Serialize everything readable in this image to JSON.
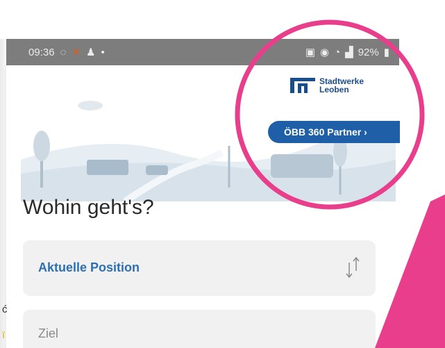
{
  "status_bar": {
    "time": "09:36",
    "battery": "92%"
  },
  "logo": {
    "line1": "Stadtwerke",
    "line2": "Leoben"
  },
  "partner_button": {
    "label": "ÖBB 360 Partner ›"
  },
  "heading": "Wohin geht's?",
  "origin_field": {
    "value": "Aktuelle Position"
  },
  "destination_field": {
    "placeholder": "Ziel"
  },
  "edge_text": {
    "left_glyph_1": "ć",
    "left_glyph_2": "ï"
  },
  "colors": {
    "highlight": "#e83e8c",
    "brand_blue": "#1f5fa8",
    "link_blue": "#2d6fb3",
    "status_bar": "#7d7d7d"
  }
}
